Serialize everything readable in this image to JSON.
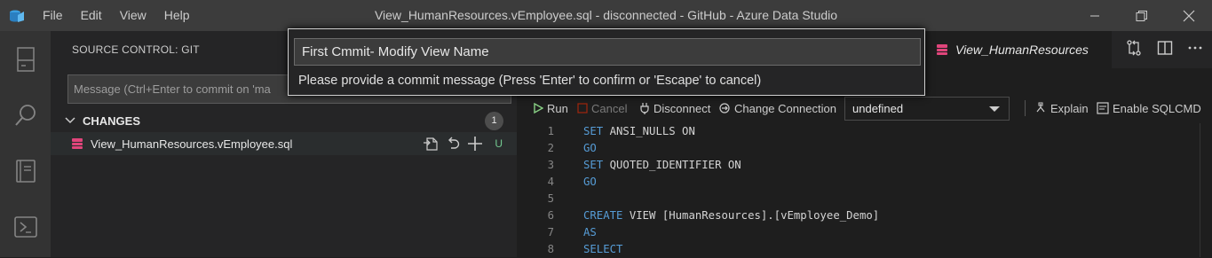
{
  "titlebar": {
    "menu": [
      "File",
      "Edit",
      "View",
      "Help"
    ],
    "window_title": "View_HumanResources.vEmployee.sql - disconnected - GitHub - Azure Data Studio"
  },
  "sidebar": {
    "header": "SOURCE CONTROL: GIT",
    "commit_placeholder": "Message (Ctrl+Enter to commit on 'ma",
    "changes_label": "CHANGES",
    "changes_count": "1",
    "files": [
      {
        "name": "View_HumanResources.vEmployee.sql",
        "status": "U"
      }
    ]
  },
  "editor": {
    "tab_title": "View_HumanResources",
    "toolbar": {
      "run": "Run",
      "cancel": "Cancel",
      "disconnect": "Disconnect",
      "change_connection": "Change Connection",
      "database": "undefined",
      "explain": "Explain",
      "enable_sqlcmd": "Enable SQLCMD"
    },
    "lines": [
      {
        "n": "1",
        "kw": "SET",
        "rest": " ANSI_NULLS ON"
      },
      {
        "n": "2",
        "kw": "GO",
        "rest": ""
      },
      {
        "n": "3",
        "kw": "SET",
        "rest": " QUOTED_IDENTIFIER ON"
      },
      {
        "n": "4",
        "kw": "GO",
        "rest": ""
      },
      {
        "n": "5",
        "kw": "",
        "rest": ""
      },
      {
        "n": "6",
        "kw": "CREATE",
        "rest": " VIEW [HumanResources].[vEmployee_Demo]"
      },
      {
        "n": "7",
        "kw": "AS",
        "rest": ""
      },
      {
        "n": "8",
        "kw": "SELECT",
        "rest": ""
      }
    ]
  },
  "quick_input": {
    "value": "First Cmmit- Modify View Name",
    "message": "Please provide a commit message (Press 'Enter' to confirm or 'Escape' to cancel)"
  },
  "colors": {
    "accent_red": "#e0457b",
    "keyword_blue": "#569cd6",
    "untracked_green": "#73c991",
    "run_green": "#89d185",
    "logo_blue": "#3b9fe0"
  }
}
